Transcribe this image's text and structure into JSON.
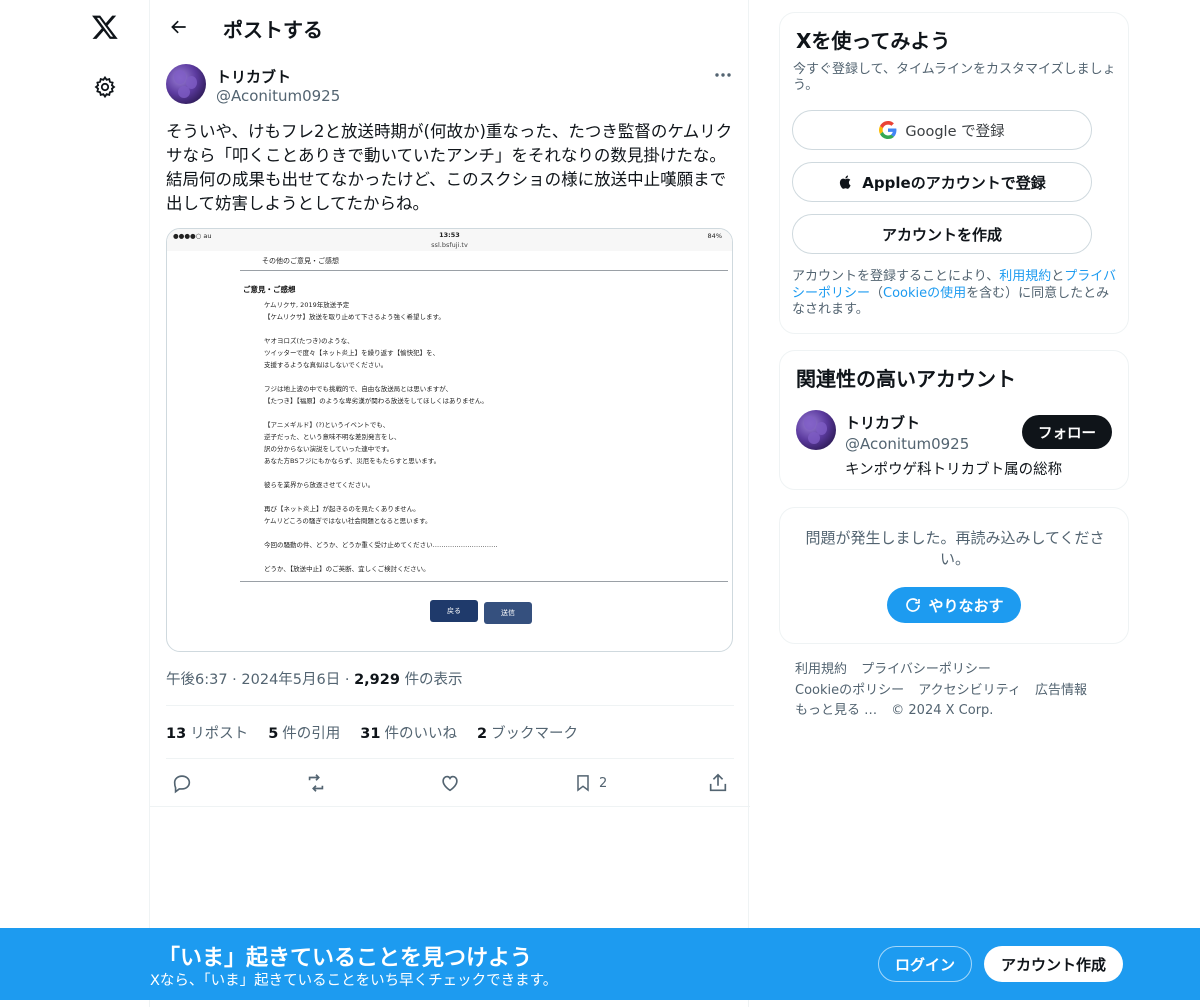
{
  "header": {
    "title": "ポストする"
  },
  "post": {
    "author_name": "トリカブト",
    "author_handle": "@Aconitum0925",
    "text": "そういや、けもフレ2と放送時期が(何故か)重なった、たつき監督のケムリクサなら「叩くことありきで動いていたアンチ」をそれなりの数見掛けたな。結局何の成果も出せてなかったけど、このスクショの様に放送中止嘆願まで出して妨害しようとしてたからね。",
    "time": "午後6:37",
    "date": "2024年5月6日",
    "views_count": "2,929",
    "views_label": "件の表示",
    "stats": {
      "reposts_count": "13",
      "reposts_label": "リポスト",
      "quotes_count": "5",
      "quotes_label": "件の引用",
      "likes_count": "31",
      "likes_label": "件のいいね",
      "bookmarks_count": "2",
      "bookmarks_label": "ブックマーク"
    },
    "bookmark_action_count": "2"
  },
  "screenshot": {
    "carrier": "●●●●○ au",
    "time": "13:53",
    "url": "ssl.bsfuji.tv",
    "battery": "84%",
    "head": "その他のご意見・ご感想",
    "section": "ご意見・ご感想",
    "body": "ケムリクサ, 2019年放送予定\n【ケムリクサ】放送を取り止めて下さるよう強く希望します。\n\nヤオヨロズ(たつき)のような、\nツイッターで度々【ネット炎上】を繰り返す【愉快犯】を、\n支援するような真似はしないでください。\n\nフジは地上波の中でも挑戦的で、自由な放送局とは思いますが、\n【たつき】【福原】のような卑劣漢が関わる放送をしてほしくはありません。\n\n【アニメギルド】(?)というイベントでも、\n逆子だった、という意味不明な差別発言をし、\n訳の分からない演説をしていった連中です。\nあなた方BSフジにもかならず、災厄をもたらすと思います。\n\n彼らを業界から放逐させてください。\n\n再び【ネット炎上】が起きるのを見たくありません。\nケムリどころの騒ぎではない社会問題となると思います。\n\n今回の騒動の件、どうか、どうか重く受け止めてください…………………………\n\nどうか、【放送中止】のご英断、宜しくご検討ください。",
    "back_label": "戻る",
    "send_label": "送信"
  },
  "signup_card": {
    "title": "Xを使ってみよう",
    "subtitle": "今すぐ登録して、タイムラインをカスタマイズしましょう。",
    "google_label": "Google で登録",
    "apple_label": "Appleのアカウントで登録",
    "create_label": "アカウントを作成",
    "legal_1": "アカウントを登録することにより、",
    "legal_terms": "利用規約",
    "legal_and": "と",
    "legal_privacy": "プライバシーポリシー",
    "legal_2": "（",
    "legal_cookie": "Cookieの使用",
    "legal_3": "を含む）に同意したとみなされます。"
  },
  "related": {
    "title": "関連性の高いアカウント",
    "name": "トリカブト",
    "handle": "@Aconitum0925",
    "bio": "キンポウゲ科トリカブト属の総称",
    "follow_label": "フォロー"
  },
  "error_card": {
    "message": "問題が発生しました。再読み込みしてください。",
    "retry_label": "やりなおす"
  },
  "footer": {
    "links": [
      "利用規約",
      "プライバシーポリシー",
      "Cookieのポリシー",
      "アクセシビリティ",
      "広告情報",
      "もっと見る …",
      "© 2024 X Corp."
    ]
  },
  "banner": {
    "title": "「いま」起きていることを見つけよう",
    "subtitle": "Xなら、「いま」起きていることをいち早くチェックできます。",
    "login_label": "ログイン",
    "signup_label": "アカウント作成"
  },
  "colors": {
    "accent": "#1d9bf0",
    "text": "#0f1419",
    "muted": "#536471",
    "border": "#eff3f4"
  },
  "icons": [
    "x-logo-icon",
    "gear-icon",
    "back-arrow-icon",
    "more-icon",
    "reply-icon",
    "repost-icon",
    "like-icon",
    "bookmark-icon",
    "share-icon",
    "google-icon",
    "apple-icon",
    "refresh-icon"
  ]
}
